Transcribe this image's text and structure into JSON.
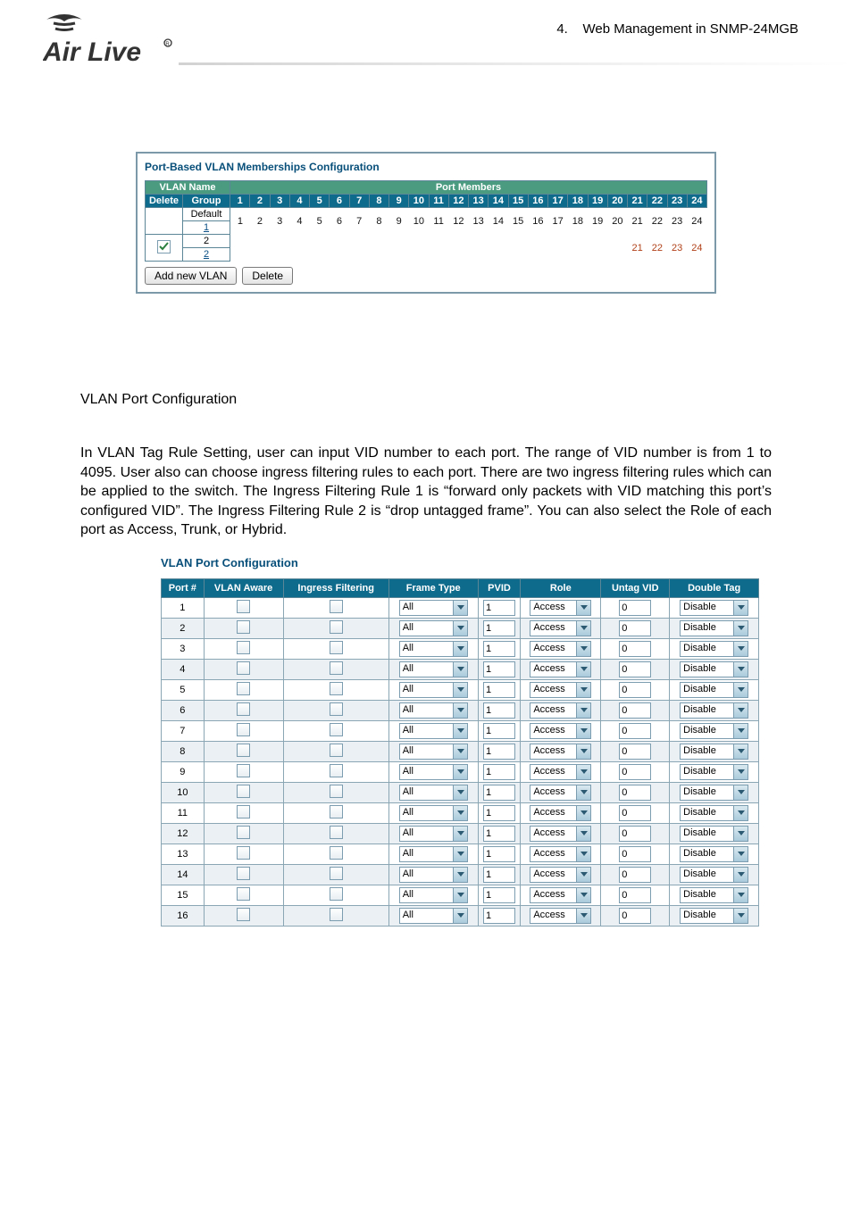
{
  "breadcrumb": {
    "num": "4.",
    "text": "Web Management in SNMP-24MGB"
  },
  "pbvmc": {
    "title": "Port-Based VLAN Memberships Configuration",
    "vlan_name_hdr": "VLAN Name",
    "port_members_hdr": "Port Members",
    "delete_hdr": "Delete",
    "group_hdr": "Group",
    "cols": [
      "1",
      "2",
      "3",
      "4",
      "5",
      "6",
      "7",
      "8",
      "9",
      "10",
      "11",
      "12",
      "13",
      "14",
      "15",
      "16",
      "17",
      "18",
      "19",
      "20",
      "21",
      "22",
      "23",
      "24"
    ],
    "rows": [
      {
        "name": "Default",
        "link": "1",
        "nums": [
          "1",
          "2",
          "3",
          "4",
          "5",
          "6",
          "7",
          "8",
          "9",
          "10",
          "11",
          "12",
          "13",
          "14",
          "15",
          "16",
          "17",
          "18",
          "19",
          "20",
          "21",
          "22",
          "23",
          "24"
        ]
      },
      {
        "name": "2",
        "link": "2",
        "nums": [
          "",
          "",
          "",
          "",
          "",
          "",
          "",
          "",
          "",
          "",
          "",
          "",
          "",
          "",
          "",
          "",
          "",
          "",
          "",
          "",
          "21",
          "22",
          "23",
          "24"
        ],
        "checked": true
      }
    ],
    "btn_add": "Add new VLAN",
    "btn_del": "Delete"
  },
  "sec_heading": "VLAN Port Configuration",
  "bodytext": "In VLAN Tag Rule Setting, user can input VID number to each port. The range of VID number is from 1 to 4095. User also can choose ingress filtering rules to each port. There are two ingress filtering rules which can be applied to the switch. The Ingress Filtering Rule 1 is “forward only packets with VID matching this port’s configured VID”. The Ingress Filtering Rule 2 is “drop untagged frame”. You can also select the Role of each port as Access, Trunk, or Hybrid.",
  "vpc": {
    "title": "VLAN Port Configuration",
    "headers": [
      "Port #",
      "VLAN Aware",
      "Ingress Filtering",
      "Frame Type",
      "PVID",
      "Role",
      "Untag VID",
      "Double Tag"
    ],
    "frame": "All",
    "role": "Access",
    "dtag": "Disable",
    "rows": [
      {
        "port": "1",
        "pvid": "1",
        "untag": "0"
      },
      {
        "port": "2",
        "pvid": "1",
        "untag": "0"
      },
      {
        "port": "3",
        "pvid": "1",
        "untag": "0"
      },
      {
        "port": "4",
        "pvid": "1",
        "untag": "0"
      },
      {
        "port": "5",
        "pvid": "1",
        "untag": "0"
      },
      {
        "port": "6",
        "pvid": "1",
        "untag": "0"
      },
      {
        "port": "7",
        "pvid": "1",
        "untag": "0"
      },
      {
        "port": "8",
        "pvid": "1",
        "untag": "0"
      },
      {
        "port": "9",
        "pvid": "1",
        "untag": "0"
      },
      {
        "port": "10",
        "pvid": "1",
        "untag": "0"
      },
      {
        "port": "11",
        "pvid": "1",
        "untag": "0"
      },
      {
        "port": "12",
        "pvid": "1",
        "untag": "0"
      },
      {
        "port": "13",
        "pvid": "1",
        "untag": "0"
      },
      {
        "port": "14",
        "pvid": "1",
        "untag": "0"
      },
      {
        "port": "15",
        "pvid": "1",
        "untag": "0"
      },
      {
        "port": "16",
        "pvid": "1",
        "untag": "0"
      }
    ]
  }
}
